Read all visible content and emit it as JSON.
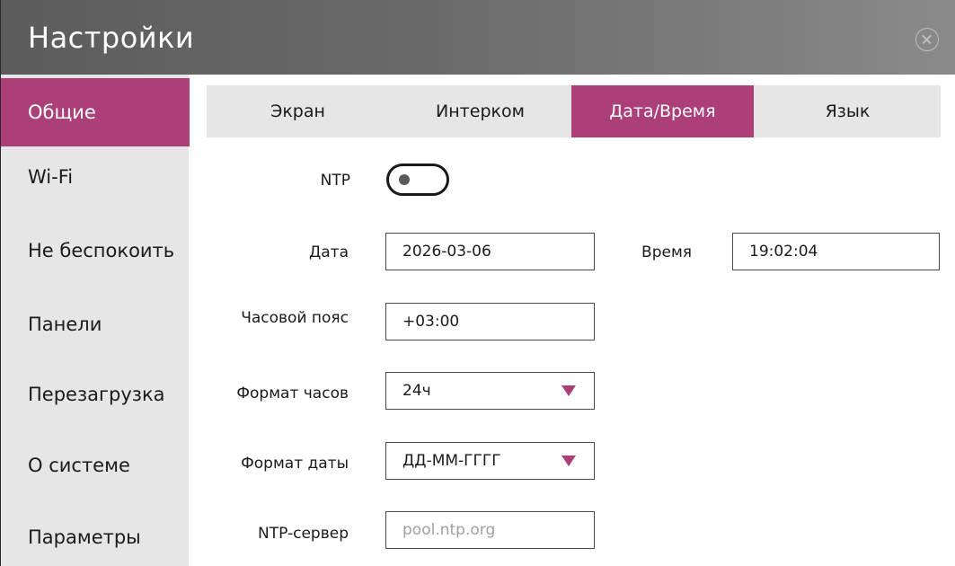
{
  "window": {
    "title": "Настройки",
    "close_icon": "close-circle-icon"
  },
  "sidebar": {
    "items": [
      {
        "label": "Общие",
        "active": true
      },
      {
        "label": "Wi-Fi",
        "active": false
      },
      {
        "label": "Не беспокоить",
        "active": false
      },
      {
        "label": "Панели",
        "active": false
      },
      {
        "label": "Перезагрузка",
        "active": false
      },
      {
        "label": "О системе",
        "active": false
      },
      {
        "label": "Параметры",
        "active": false
      }
    ]
  },
  "tabs": [
    {
      "label": "Экран",
      "active": false
    },
    {
      "label": "Интерком",
      "active": false
    },
    {
      "label": "Дата/Время",
      "active": true
    },
    {
      "label": "Язык",
      "active": false
    }
  ],
  "form": {
    "ntp": {
      "label": "NTP",
      "enabled": false
    },
    "date": {
      "label": "Дата",
      "value": "2026-03-06"
    },
    "time": {
      "label": "Время",
      "value": "19:02:04"
    },
    "timezone": {
      "label": "Часовой пояс",
      "value": "+03:00"
    },
    "hour_format": {
      "label": "Формат часов",
      "value": "24ч"
    },
    "date_format": {
      "label": "Формат даты",
      "value": "ДД-ММ-ГГГГ"
    },
    "ntp_server": {
      "label": "NTP-сервер",
      "placeholder": "pool.ntp.org"
    }
  },
  "colors": {
    "accent": "#ad3f78",
    "sidebar_bg": "#e6e6e6",
    "titlebar_bg": "#6a6a6a"
  }
}
